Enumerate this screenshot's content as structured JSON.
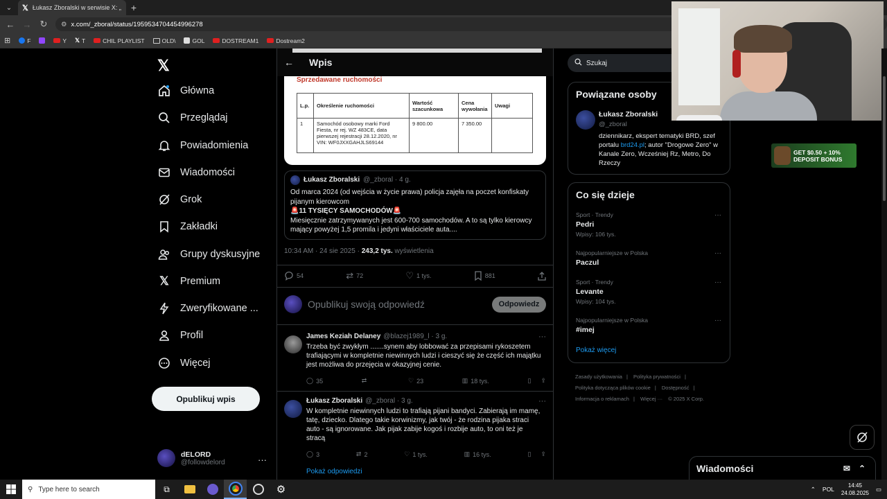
{
  "browser": {
    "tab_title": "Łukasz Zboralski w serwisie X: „",
    "url": "x.com/_zboral/status/1959534704454996278",
    "bookmarks": [
      {
        "label": "F",
        "icon": "facebook-icon"
      },
      {
        "label": "",
        "icon": "twitch-icon"
      },
      {
        "label": "Y",
        "icon": "youtube-icon"
      },
      {
        "label": "T",
        "icon": "x-icon"
      },
      {
        "label": "CHIL PLAYLIST",
        "icon": "youtube-icon"
      },
      {
        "label": "OLD\\",
        "icon": "folder-icon"
      },
      {
        "label": "GOL",
        "icon": "gol-icon"
      },
      {
        "label": "DOSTREAM1",
        "icon": "youtube-icon"
      },
      {
        "label": "Dostream2",
        "icon": "youtube-icon"
      }
    ]
  },
  "sidebar": {
    "items": [
      {
        "label": "Główna",
        "icon": "home-icon"
      },
      {
        "label": "Przeglądaj",
        "icon": "search-icon"
      },
      {
        "label": "Powiadomienia",
        "icon": "bell-icon"
      },
      {
        "label": "Wiadomości",
        "icon": "mail-icon"
      },
      {
        "label": "Grok",
        "icon": "grok-icon"
      },
      {
        "label": "Zakładki",
        "icon": "bookmark-icon"
      },
      {
        "label": "Grupy dyskusyjne",
        "icon": "communities-icon"
      },
      {
        "label": "Premium",
        "icon": "x-icon"
      },
      {
        "label": "Zweryfikowane ...",
        "icon": "lightning-icon"
      },
      {
        "label": "Profil",
        "icon": "person-icon"
      },
      {
        "label": "Więcej",
        "icon": "more-circle-icon"
      }
    ],
    "publish_label": "Opublikuj wpis",
    "account": {
      "name": "dELORD",
      "handle": "@followdelord"
    }
  },
  "post": {
    "header_title": "Wpis",
    "document": {
      "title": "Sprzedawane ruchomości",
      "headers": [
        "L.p.",
        "Określenie ruchomości",
        "Wartość szacunkowa",
        "Cena wywołania",
        "Uwagi"
      ],
      "row": [
        "1",
        "Samochód osobowy marki Ford Fiesta, nr rej. WZ 483CE, data pierwszej rejestracji 28.12.2020, nr VIN: WF0JXXGAHJLS69144",
        "9 800.00",
        "7 350.00",
        ""
      ]
    },
    "quote": {
      "name": "Łukasz Zboralski",
      "handle": "@_zboral · 4 g.",
      "lines": [
        "Od marca 2024 (od wejścia w życie prawa) policja zajęła na poczet konfiskaty pijanym kierowcom",
        "🚨11 TYSIĘCY SAMOCHODÓW🚨",
        "Miesięcznie zatrzymywanych jest 600-700 samochodów. A to są tylko kierowcy mający powyżej 1,5 promila i jedyni właściciele auta...."
      ]
    },
    "meta": {
      "time": "10:34 AM · 24 sie 2025 · ",
      "views": "243,2 tys.",
      "views_label": " wyświetlenia"
    },
    "stats": {
      "replies": "54",
      "reposts": "72",
      "likes": "1 tys.",
      "bookmarks": "881"
    },
    "reply_placeholder": "Opublikuj swoją odpowiedź",
    "reply_button": "Odpowiedz"
  },
  "replies": [
    {
      "name": "James Keziah Delaney",
      "handle": "@blazej1989_l · 3 g.",
      "text": "Trzeba być zwykłym .......synem aby lobbować za przepisami rykoszetem trafiającymi w kompletnie niewinnych ludzi i cieszyć się że część ich majątku jest możliwa do przejęcia w okazyjnej cenie.",
      "replies": "35",
      "reposts": "",
      "likes": "23",
      "views": "18 tys."
    },
    {
      "name": "Łukasz Zboralski",
      "handle": "@_zboral · 3 g.",
      "text": "W kompletnie niewinnych ludzi to trafiają pijani bandyci. Zabierają im mamę, tatę, dziecko. Dlatego takie korwinizmy, jak twój - że rodzina pijaka straci auto - są ignorowane. Jak pijak zabije kogoś i rozbije auto, to oni też je stracą",
      "replies": "3",
      "reposts": "2",
      "likes": "1 tys.",
      "views": "16 tys."
    }
  ],
  "show_replies": "Pokaż odpowiedzi",
  "right": {
    "search_placeholder": "Szukaj",
    "related_title": "Powiązane osoby",
    "related": {
      "name": "Łukasz Zboralski",
      "handle": "@_zboral",
      "bio_pre": "dziennikarz, ekspert tematyki BRD, szef portalu ",
      "bio_link": "brd24.pl",
      "bio_post": "; autor \"Drogowe Zero\" w Kanale Zero, Wcześniej Rz, Metro, Do Rzeczy"
    },
    "trends_title": "Co się dzieje",
    "trends": [
      {
        "category": "Sport · Trendy",
        "name": "Pedri",
        "count": "Wpisy: 106 tys."
      },
      {
        "category": "Najpopularniejsze w Polska",
        "name": "Paczul",
        "count": ""
      },
      {
        "category": "Sport · Trendy",
        "name": "Levante",
        "count": "Wpisy: 104 tys."
      },
      {
        "category": "Najpopularniejsze w Polska",
        "name": "#imej",
        "count": ""
      }
    ],
    "show_more": "Pokaż więcej",
    "footer": [
      "Zasady użytkowania",
      "Polityka prywatności",
      "Polityka dotycząca plików cookie",
      "Dostępność",
      "Informacja o reklamach",
      "Więcej ···",
      "© 2025 X Corp."
    ]
  },
  "ad": {
    "text": "GET $0.50 + 10% DEPOSIT BONUS"
  },
  "dm": {
    "title": "Wiadomości"
  },
  "taskbar": {
    "search_placeholder": "Type here to search",
    "lang": "POL",
    "time": "14:45",
    "date": "24.08.2025"
  }
}
